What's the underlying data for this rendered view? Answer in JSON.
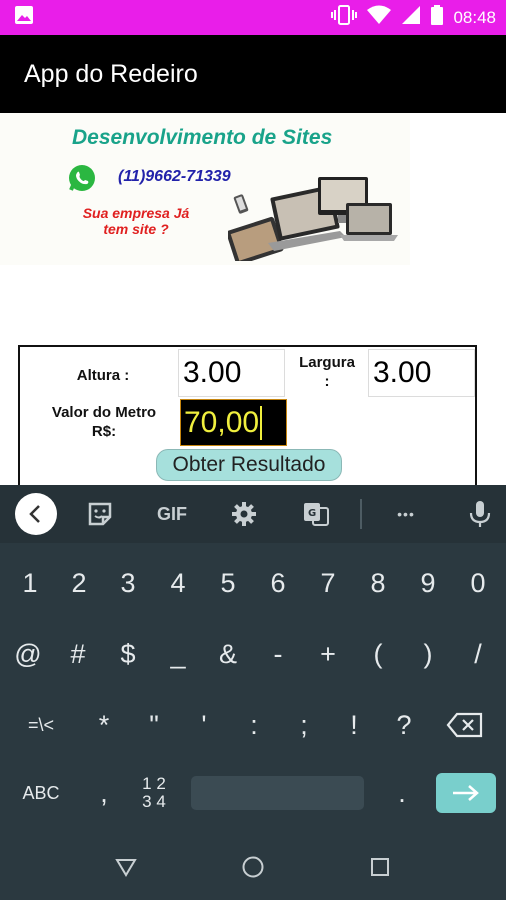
{
  "status_bar": {
    "time": "08:48",
    "color": "#e91ee9",
    "icons": [
      "image-icon",
      "vibrate-icon",
      "wifi-icon",
      "signal-icon",
      "battery-icon"
    ]
  },
  "app_bar": {
    "title": "App do Redeiro"
  },
  "banner": {
    "title": "Desenvolvimento de Sites",
    "phone": "(11)9662-71339",
    "question_line1": "Sua empresa Já",
    "question_line2": "tem site ?"
  },
  "form": {
    "altura_label": "Altura :",
    "altura_value": "3.00",
    "largura_label_line1": "Largura",
    "largura_label_line2": ":",
    "largura_value": "3.00",
    "valor_label_line1": "Valor do Metro",
    "valor_label_line2": "R$:",
    "valor_value": "70,00",
    "button_label": "Obter Resultado"
  },
  "keyboard": {
    "toolbar": [
      "back-icon",
      "sticker-icon",
      "GIF",
      "gear-icon",
      "translate-icon",
      "more-icon",
      "mic-icon"
    ],
    "gif_label": "GIF",
    "more_label": "•••",
    "row1": [
      "1",
      "2",
      "3",
      "4",
      "5",
      "6",
      "7",
      "8",
      "9",
      "0"
    ],
    "row2": [
      "@",
      "#",
      "$",
      "_",
      "&",
      "-",
      "+",
      "(",
      ")",
      "/"
    ],
    "row3": [
      "=\\<",
      "*",
      "\"",
      "'",
      ":",
      ";",
      "!",
      "?"
    ],
    "row4_abc": "ABC",
    "row4_comma": ",",
    "row4_nums_top": "1 2",
    "row4_nums_bottom": "3 4",
    "row4_period": "."
  },
  "nav_bar": {
    "buttons": [
      "back-triangle-icon",
      "home-circle-icon",
      "recents-square-icon"
    ]
  }
}
